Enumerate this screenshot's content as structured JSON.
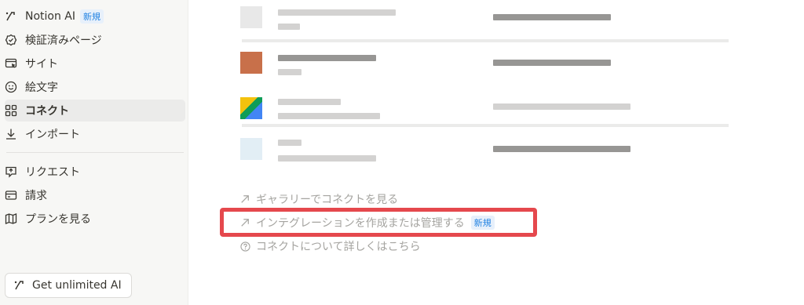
{
  "sidebar": {
    "items": [
      {
        "label": "Notion AI",
        "badge": "新規",
        "icon": "notion-ai-icon"
      },
      {
        "label": "検証済みページ",
        "icon": "verified-badge-icon"
      },
      {
        "label": "サイト",
        "icon": "site-cursor-icon"
      },
      {
        "label": "絵文字",
        "icon": "smiley-icon"
      },
      {
        "label": "コネクト",
        "icon": "grid-icon",
        "active": true
      },
      {
        "label": "インポート",
        "icon": "download-icon"
      },
      {
        "label": "リクエスト",
        "icon": "request-icon"
      },
      {
        "label": "請求",
        "icon": "credit-card-icon"
      },
      {
        "label": "プランを見る",
        "icon": "map-icon"
      }
    ],
    "get_ai_label": "Get unlimited AI"
  },
  "main": {
    "links": [
      {
        "label": "ギャラリーでコネクトを見る",
        "icon": "arrow-up-right-icon"
      },
      {
        "label": "インテグレーションを作成または管理する",
        "badge": "新規",
        "icon": "arrow-up-right-icon"
      },
      {
        "label": "コネクトについて詳しくはこちら",
        "icon": "question-circle-icon"
      }
    ]
  },
  "colors": {
    "accent": "#2383e2",
    "highlight": "#e5484d",
    "sidebar_bg": "#f7f7f5"
  }
}
